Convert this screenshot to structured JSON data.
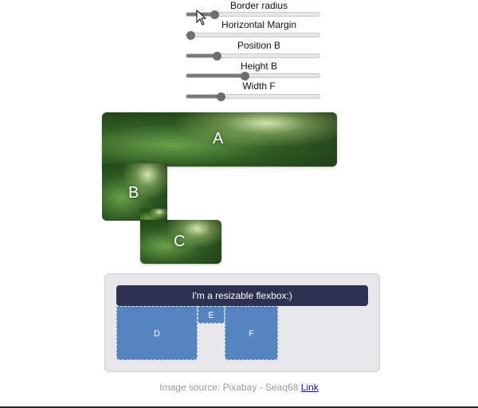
{
  "controls": [
    {
      "label": "Border radius",
      "value": 0.21
    },
    {
      "label": "Horizontal Margin",
      "value": 0.0
    },
    {
      "label": "Position B",
      "value": 0.23
    },
    {
      "label": "Height B",
      "value": 0.44
    },
    {
      "label": "Width F",
      "value": 0.26
    }
  ],
  "collage": {
    "tiles": [
      {
        "label": "A"
      },
      {
        "label": "B"
      },
      {
        "label": "C"
      }
    ]
  },
  "flex_demo": {
    "banner": "I'm a resizable flexbox:)",
    "boxes": [
      {
        "label": "D"
      },
      {
        "label": "E"
      },
      {
        "label": "F"
      }
    ]
  },
  "credit": {
    "text": "Image source: Pixabay - Seaq68",
    "link_label": "Link"
  },
  "colors": {
    "banner": "#2f3152",
    "box": "#5684be",
    "panel": "#e7e7e9"
  }
}
